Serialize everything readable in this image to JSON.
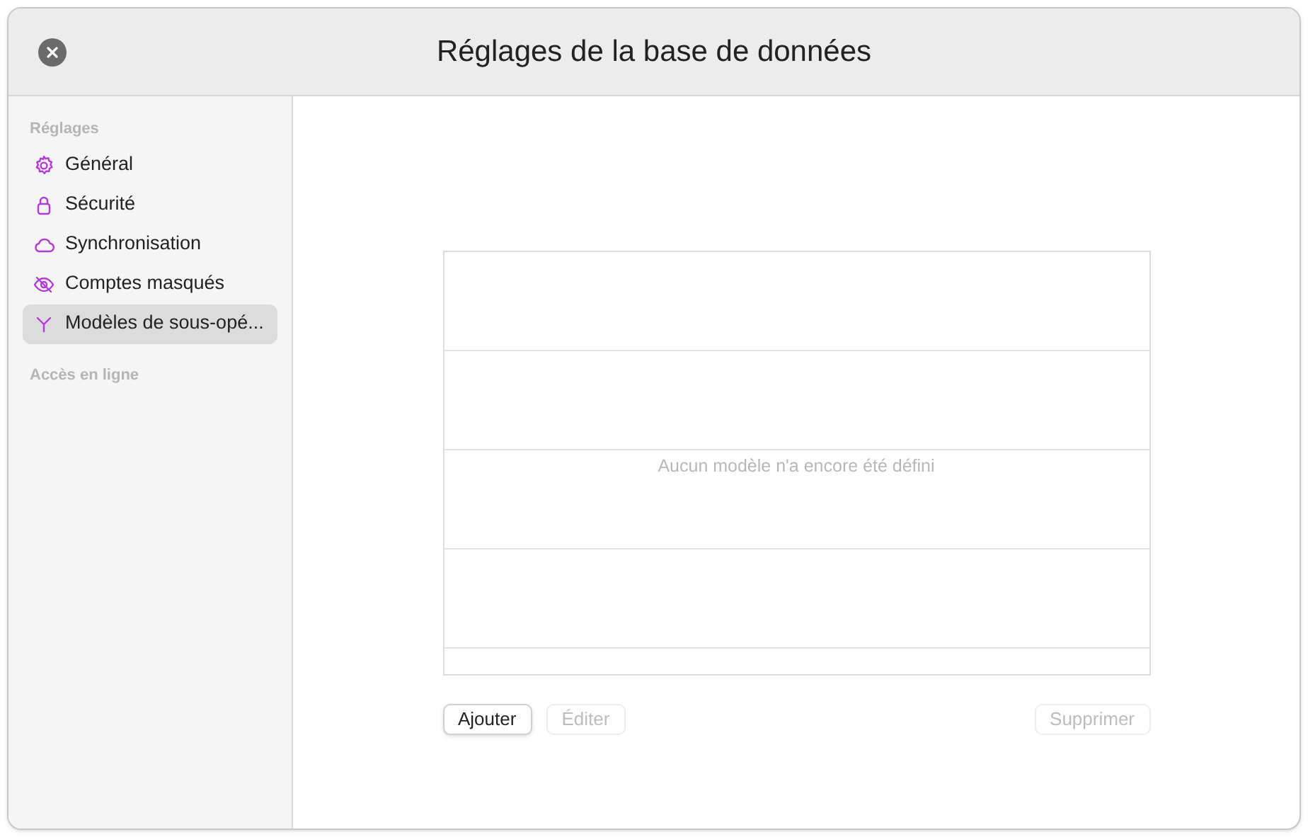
{
  "window": {
    "title": "Réglages de la base de données"
  },
  "sidebar": {
    "sections": [
      {
        "header": "Réglages",
        "items": [
          {
            "label": "Général",
            "kind": "gear",
            "selected": false
          },
          {
            "label": "Sécurité",
            "kind": "lock",
            "selected": false
          },
          {
            "label": "Synchronisation",
            "kind": "cloud",
            "selected": false
          },
          {
            "label": "Comptes masqués",
            "kind": "eye",
            "selected": false
          },
          {
            "label": "Modèles de sous-opé...",
            "kind": "fork",
            "selected": true
          }
        ]
      },
      {
        "header": "Accès en ligne"
      }
    ]
  },
  "table": {
    "empty_message": "Aucun modèle n'a encore été défini"
  },
  "buttons_left": [
    {
      "label": "Ajouter",
      "disabled": false
    },
    {
      "label": "Éditer",
      "disabled": true
    }
  ],
  "buttons_right": [
    {
      "label": "Supprimer",
      "disabled": true
    }
  ]
}
